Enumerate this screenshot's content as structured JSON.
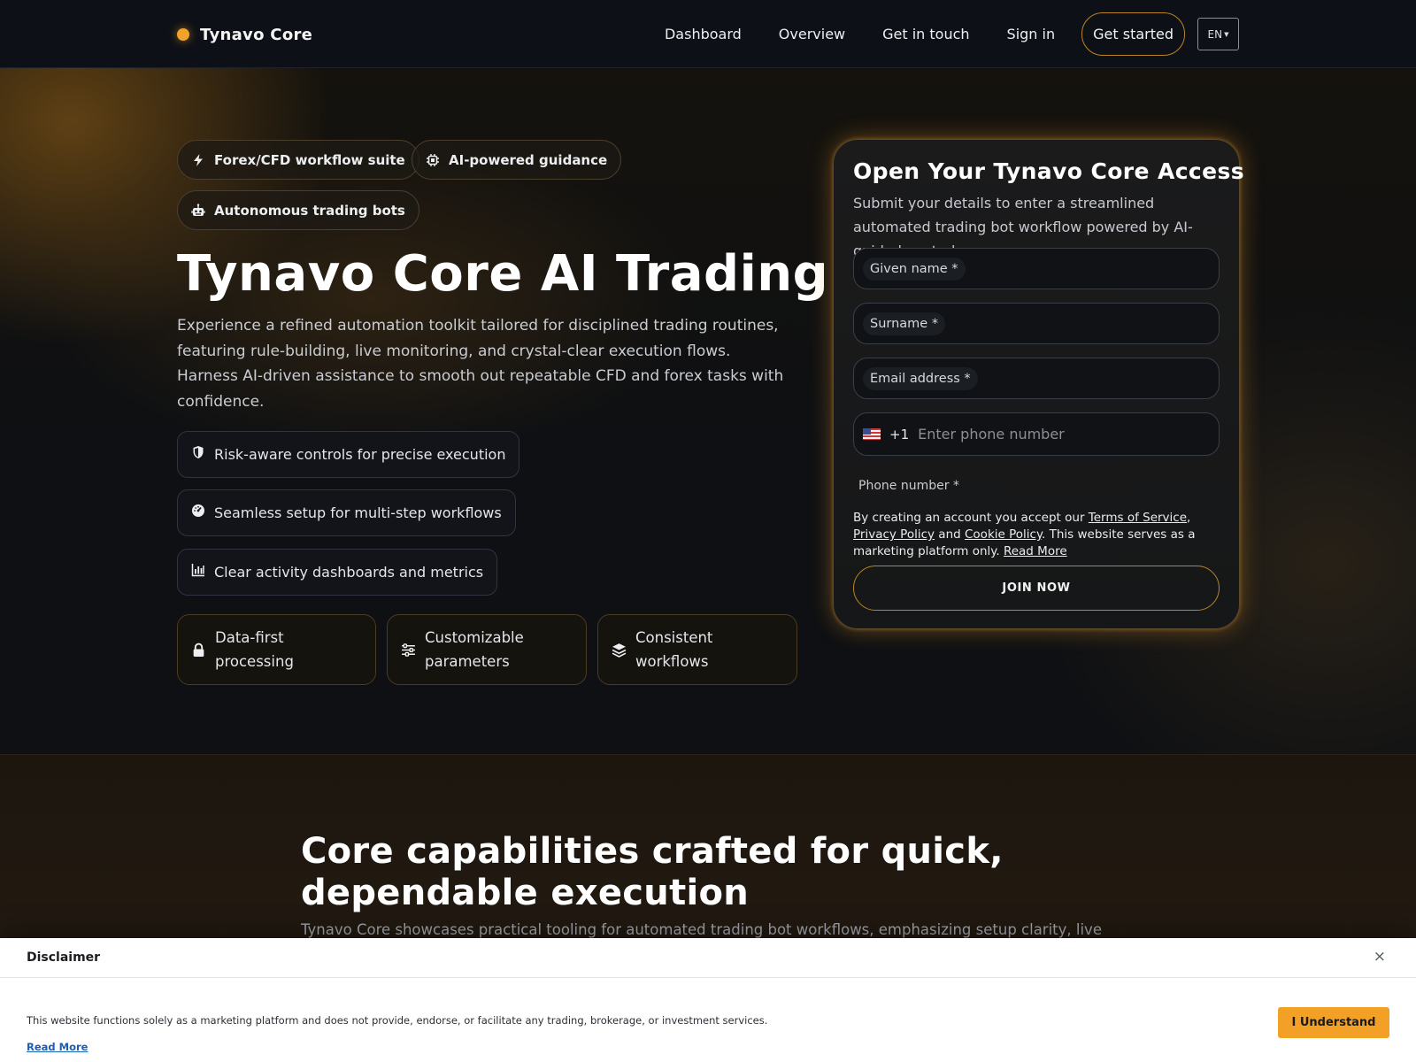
{
  "header": {
    "brand": "Tynavo Core",
    "nav": [
      "Dashboard",
      "Overview",
      "Get in touch",
      "Sign in"
    ],
    "cta": "Get started",
    "lang": "EN"
  },
  "hero": {
    "pills": [
      {
        "label": "Forex/CFD workflow suite",
        "icon": "bolt-icon"
      },
      {
        "label": "AI-powered guidance",
        "icon": "chip-icon"
      },
      {
        "label": "Autonomous trading bots",
        "icon": "robot-icon"
      }
    ],
    "title": "Tynavo Core AI Trading",
    "description": "Experience a refined automation toolkit tailored for disciplined trading routines, featuring rule-building, live monitoring, and crystal-clear execution flows. Harness AI-driven assistance to smooth out repeatable CFD and forex tasks with confidence.",
    "features": [
      {
        "label": "Risk-aware controls for precise execution",
        "icon": "shield-icon"
      },
      {
        "label": "Seamless setup for multi-step workflows",
        "icon": "gauge-icon"
      },
      {
        "label": "Clear activity dashboards and metrics",
        "icon": "bar-chart-icon"
      }
    ],
    "cards": [
      {
        "label": "Data-first processing",
        "icon": "lock-icon"
      },
      {
        "label": "Customizable parameters",
        "icon": "sliders-icon"
      },
      {
        "label": "Consistent workflows",
        "icon": "layers-icon"
      }
    ]
  },
  "signup": {
    "title": "Open Your Tynavo Core Access",
    "subtitle": "Submit your details to enter a streamlined automated trading bot workflow powered by AI-guided controls.",
    "fields": {
      "given_name": "Given name *",
      "surname": "Surname *",
      "email": "Email address *"
    },
    "phone": {
      "code": "+1",
      "placeholder": "Enter phone number",
      "label": "Phone number *"
    },
    "legal": {
      "prefix": "By creating an account you accept our ",
      "terms": "Terms of Service",
      "sep1": ", ",
      "privacy": "Privacy Policy",
      "and": " and ",
      "cookie": "Cookie Policy",
      "suffix": ". This website serves as a marketing platform only. ",
      "read_more": "Read More"
    },
    "join": "JOIN NOW"
  },
  "capabilities": {
    "title": "Core capabilities crafted for quick, dependable execution",
    "description": "Tynavo Core showcases practical tooling for automated trading bot workflows, emphasizing setup clarity, live"
  },
  "disclaimer": {
    "title": "Disclaimer",
    "close": "×",
    "text": "This website functions solely as a marketing platform and does not provide, endorse, or facilitate any trading, brokerage, or investment services.",
    "read_more": "Read More",
    "button": "I Understand"
  },
  "colors": {
    "accent": "#f2a32a",
    "accent_border": "#b98527",
    "background": "#0d1015",
    "disclaimer_bg": "#ffffff",
    "link": "#1a5fb4"
  }
}
